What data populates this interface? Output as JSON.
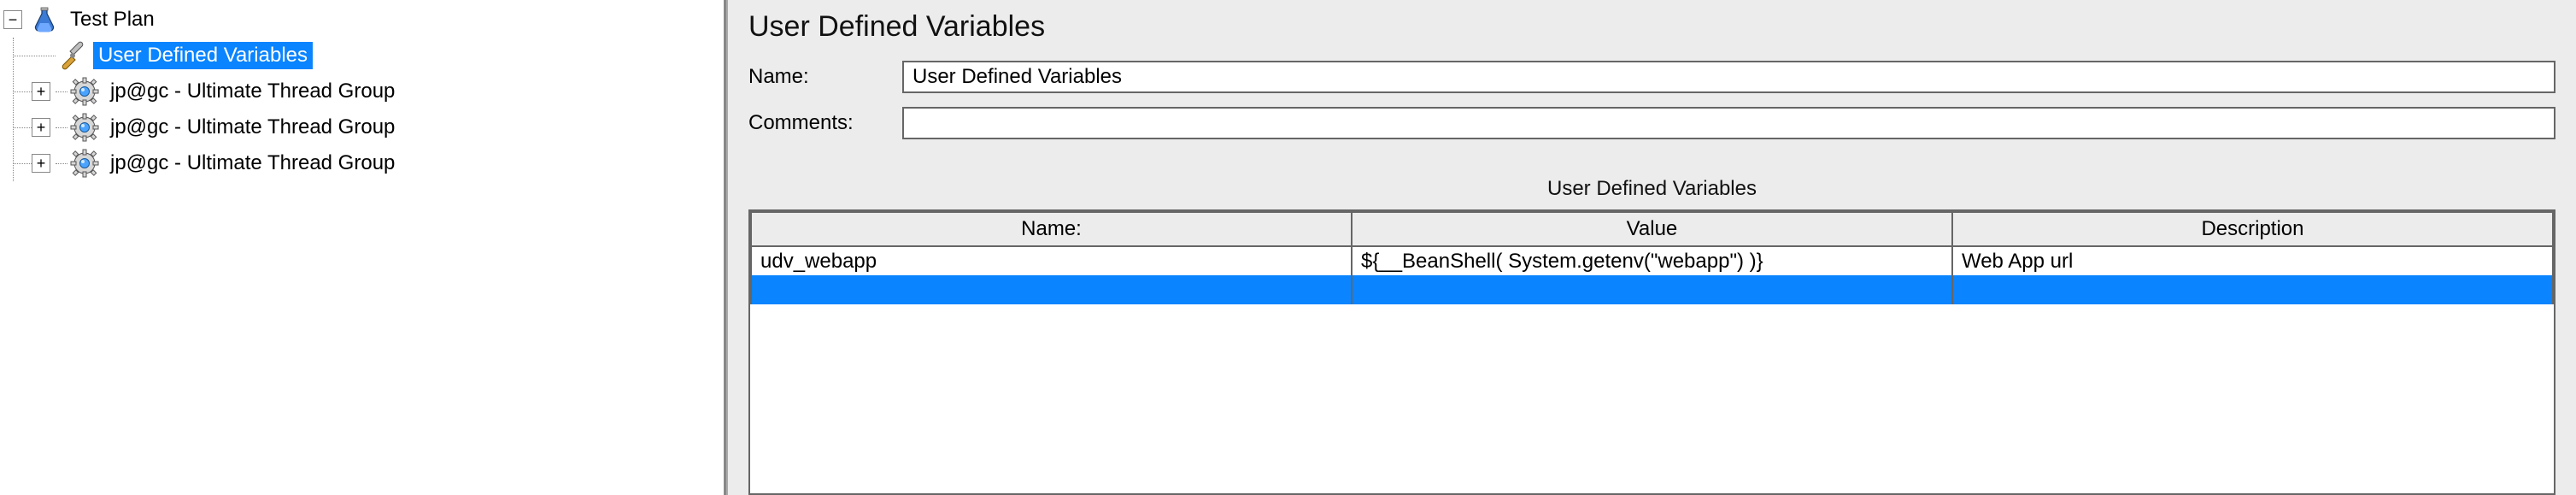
{
  "tree": {
    "root": {
      "label": "Test Plan",
      "expanded": true
    },
    "children": [
      {
        "label": "User Defined Variables",
        "icon": "wrench",
        "selected": true,
        "toggle": "none"
      },
      {
        "label": "jp@gc - Ultimate Thread Group",
        "icon": "gear",
        "selected": false,
        "toggle": "plus"
      },
      {
        "label": "jp@gc - Ultimate Thread Group",
        "icon": "gear",
        "selected": false,
        "toggle": "plus"
      },
      {
        "label": "jp@gc - Ultimate Thread Group",
        "icon": "gear",
        "selected": false,
        "toggle": "plus"
      }
    ]
  },
  "main": {
    "title": "User Defined Variables",
    "name_label": "Name:",
    "name_value": "User Defined Variables",
    "comments_label": "Comments:",
    "comments_value": "",
    "table_title": "User Defined Variables",
    "columns": {
      "name": "Name:",
      "value": "Value",
      "description": "Description"
    },
    "rows": [
      {
        "name": "udv_webapp",
        "value": "${__BeanShell( System.getenv(\"webapp\") )}",
        "description": "Web App url"
      }
    ]
  },
  "toggle_glyphs": {
    "plus": "+",
    "minus": "−"
  }
}
